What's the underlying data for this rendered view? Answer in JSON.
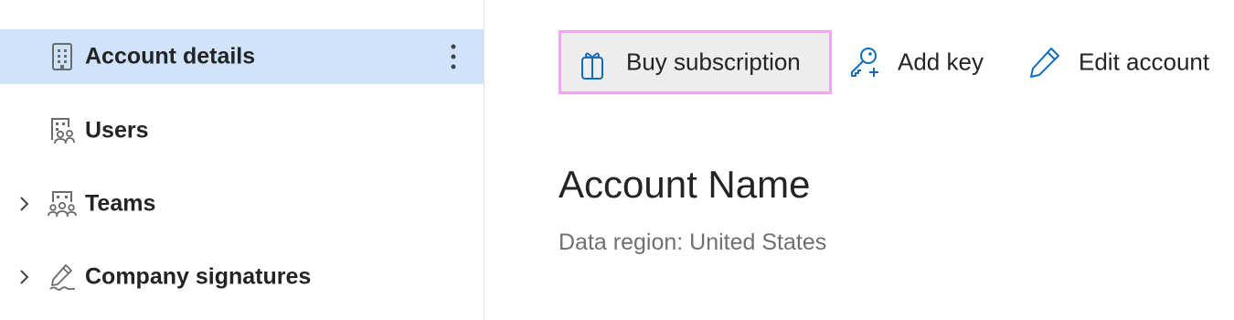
{
  "sidebar": {
    "items": [
      {
        "label": "Account details",
        "icon": "building-icon",
        "selected": true,
        "has_more_menu": true
      },
      {
        "label": "Users",
        "icon": "building-people-icon",
        "expandable": false
      },
      {
        "label": "Teams",
        "icon": "building-team-icon",
        "expandable": true
      },
      {
        "label": "Company signatures",
        "icon": "signature-icon",
        "expandable": true
      }
    ]
  },
  "toolbar": {
    "buy_label": "Buy subscription",
    "add_key_label": "Add key",
    "edit_label": "Edit account"
  },
  "main": {
    "title": "Account Name",
    "region": "Data region: United States"
  },
  "colors": {
    "selected_bg": "#cfe4fa",
    "accent": "#0f6cbd",
    "focus_outline": "#f2a5f0",
    "secondary_text": "#707070"
  }
}
